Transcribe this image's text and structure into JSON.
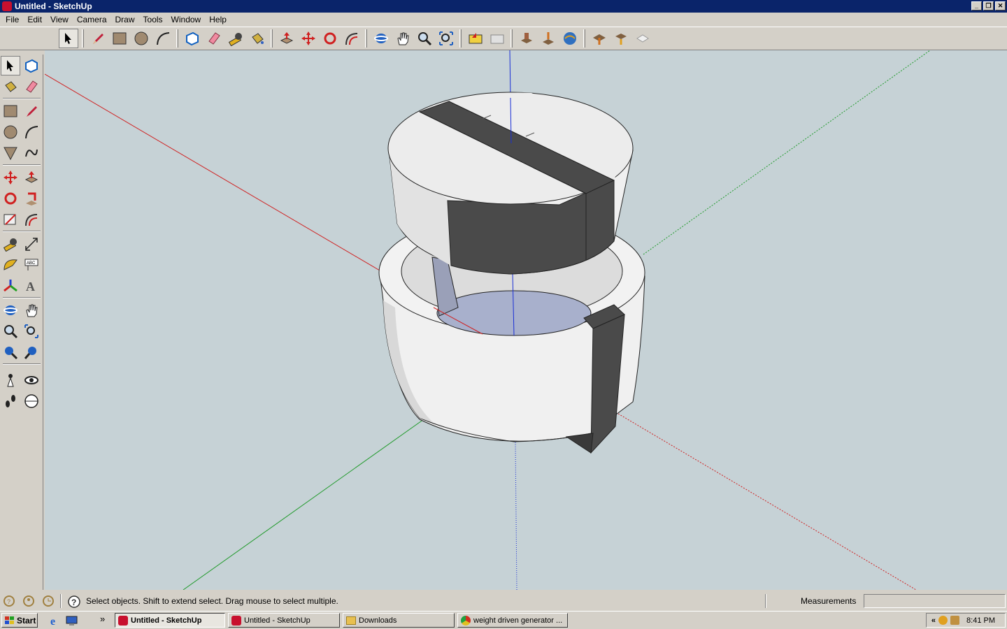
{
  "window": {
    "title": "Untitled - SketchUp"
  },
  "menu": [
    "File",
    "Edit",
    "View",
    "Camera",
    "Draw",
    "Tools",
    "Window",
    "Help"
  ],
  "toolbar_icons": [
    "select-icon",
    "pencil-icon",
    "rectangle-icon",
    "circle-icon",
    "arc-icon",
    "make-component-icon",
    "eraser-icon",
    "tape-measure-icon",
    "paint-bucket-icon",
    "push-pull-icon",
    "move-icon",
    "rotate-icon",
    "offset-icon",
    "orbit-icon",
    "pan-icon",
    "zoom-icon",
    "zoom-extents-icon",
    "previous-view-icon",
    "next-view-icon",
    "get-models-icon",
    "place-model-icon",
    "share-model-icon",
    "add-location-icon",
    "components-icon",
    "export-icon"
  ],
  "status": {
    "hint": "Select objects. Shift to extend select. Drag mouse to select multiple.",
    "measurements_label": "Measurements",
    "measurements_value": ""
  },
  "taskbar": {
    "start": "Start",
    "tasks": [
      "Untitled - SketchUp",
      "Untitled - SketchUp",
      "Downloads",
      "weight driven generator ..."
    ],
    "clock": "8:41 PM",
    "tray_chevron": "«"
  },
  "colors": {
    "viewport_bg": "#c6d2d6",
    "axis_red": "#d02020",
    "axis_green": "#1f9a2a",
    "axis_blue": "#1a2fd6",
    "face_light": "#f0f0f0",
    "face_dark": "#4a4a4a"
  }
}
